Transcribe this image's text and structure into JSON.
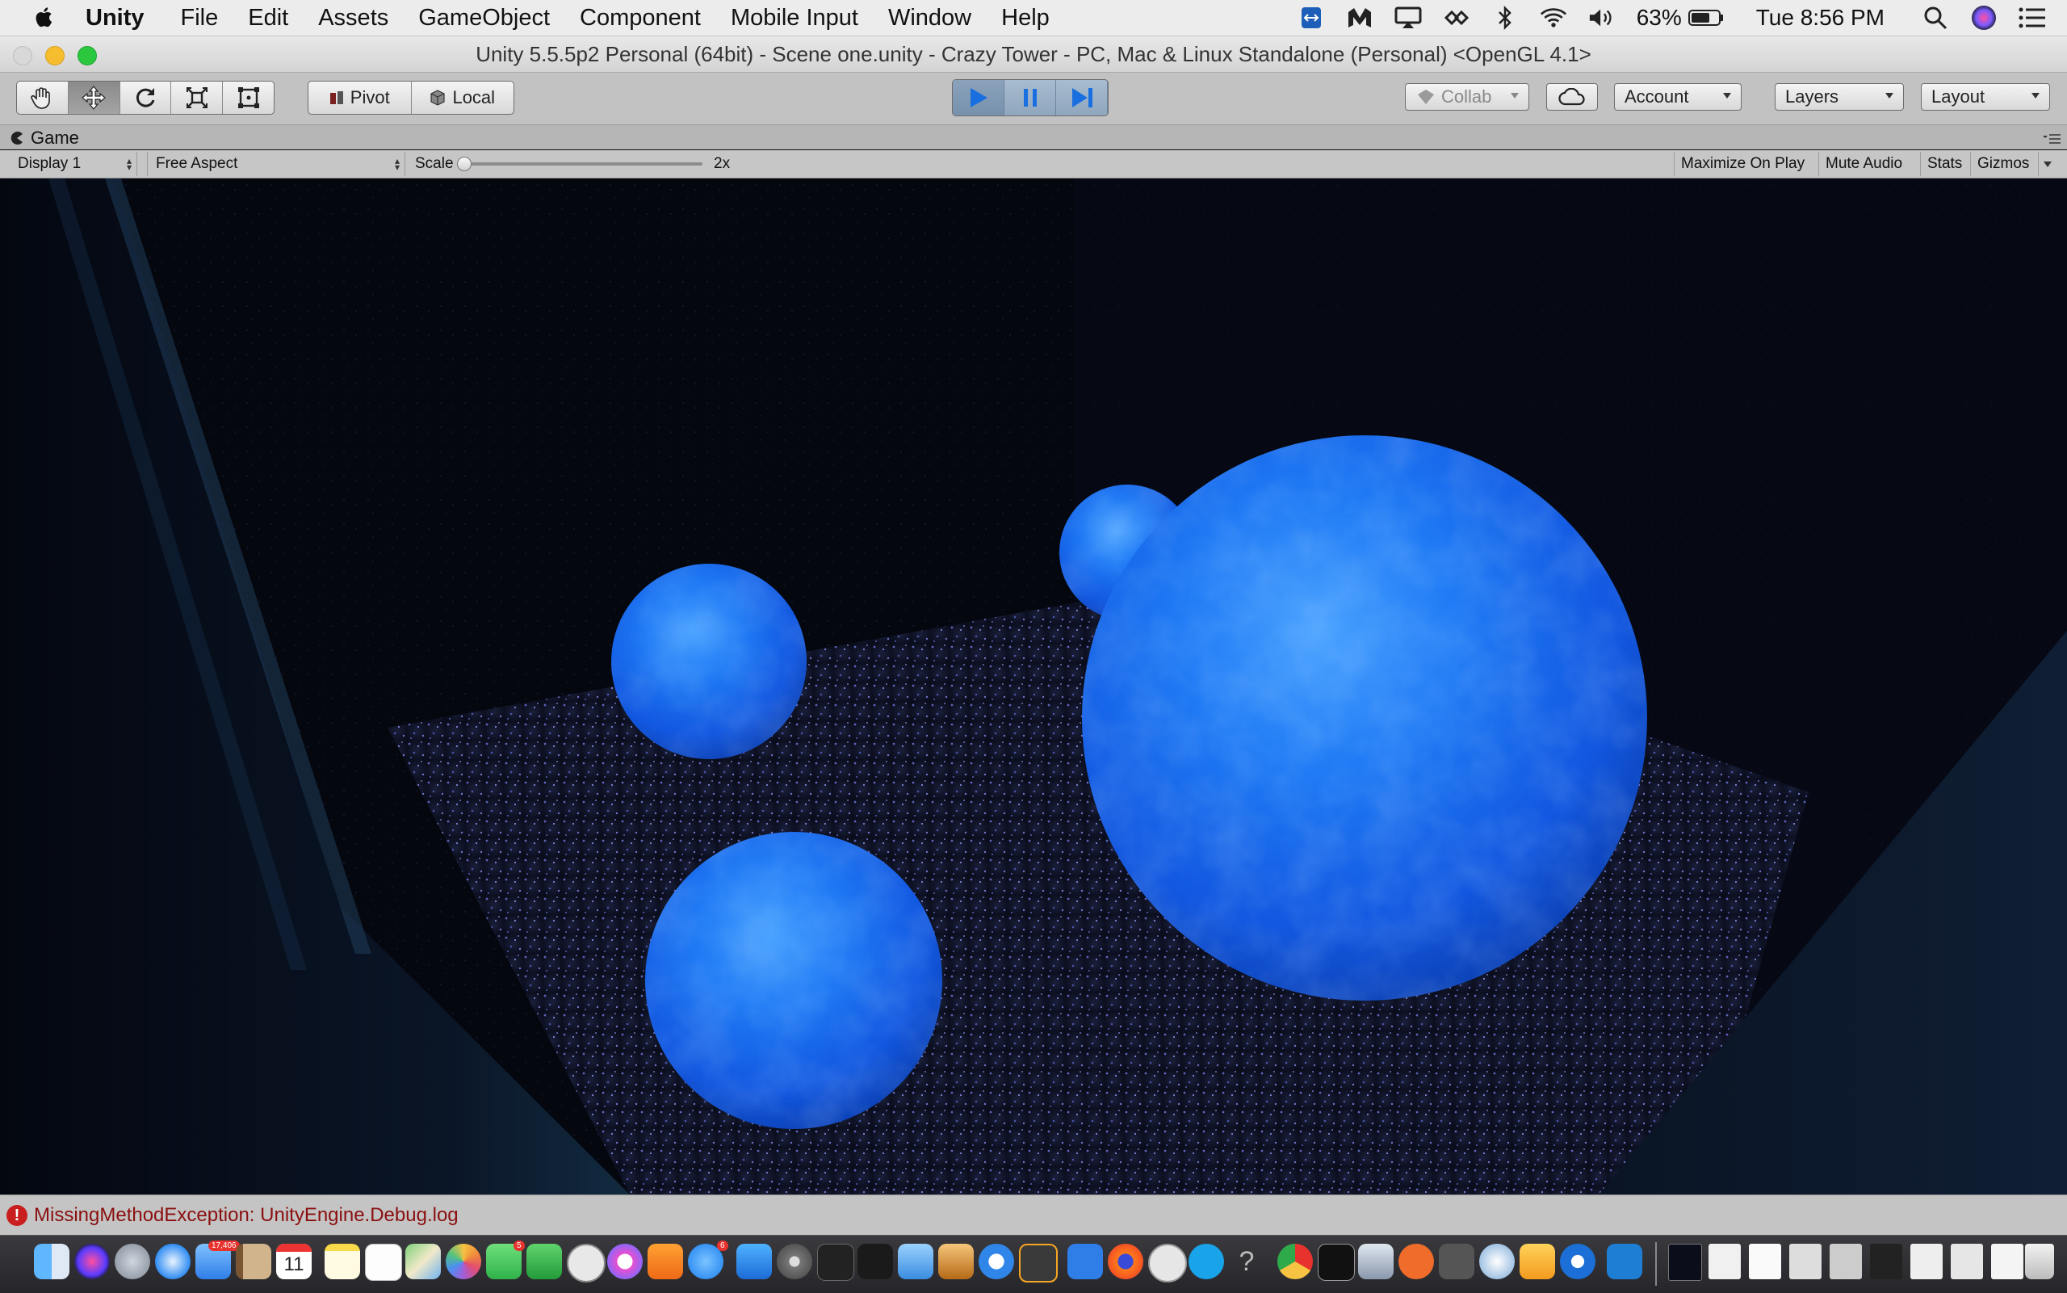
{
  "menubar": {
    "app_name": "Unity",
    "items": [
      "File",
      "Edit",
      "Assets",
      "GameObject",
      "Component",
      "Mobile Input",
      "Window",
      "Help"
    ],
    "battery_percent": "63%",
    "clock": "Tue 8:56 PM",
    "status_icons": [
      "teamviewer-icon",
      "malwarebytes-icon",
      "airplay-icon",
      "link-icon",
      "bluetooth-icon",
      "wifi-icon",
      "volume-icon",
      "battery-icon",
      "spotlight-search-icon",
      "siri-icon",
      "notification-center-icon"
    ]
  },
  "window": {
    "title": "Unity 5.5.5p2 Personal (64bit) - Scene one.unity - Crazy Tower - PC, Mac & Linux Standalone (Personal) <OpenGL 4.1>"
  },
  "toolbar": {
    "transform_tools": [
      "hand-tool",
      "move-tool",
      "rotate-tool",
      "scale-tool",
      "rect-tool"
    ],
    "active_tool": "move-tool",
    "pivot_label": "Pivot",
    "local_label": "Local",
    "play_state": "playing",
    "collab_label": "Collab",
    "account_label": "Account",
    "layers_label": "Layers",
    "layout_label": "Layout"
  },
  "game_panel": {
    "tab_label": "Game",
    "display_label": "Display 1",
    "aspect_label": "Free Aspect",
    "scale_label": "Scale",
    "scale_value": "2x",
    "scale_level": 0.0,
    "maximize_label": "Maximize On Play",
    "mute_label": "Mute Audio",
    "stats_label": "Stats",
    "gizmos_label": "Gizmos"
  },
  "console": {
    "error_message": "MissingMethodException: UnityEngine.Debug.log"
  },
  "colors": {
    "sphere_blue": "#1f6ef0",
    "play_blue": "#1a6fe0",
    "error_red": "#c81e1e",
    "menubar_bg": "#ececec",
    "toolbar_bg": "#c2c2c2"
  },
  "dock": {
    "apps": [
      "finder-icon",
      "siri-icon",
      "launchpad-icon",
      "safari-icon",
      "mail-icon",
      "contacts-icon",
      "calendar-icon",
      "notes-icon",
      "reminders-icon",
      "maps-icon",
      "photos-icon",
      "messages-icon",
      "facetime-icon",
      "numbers-icon",
      "unknown-app-icon",
      "itunes-icon",
      "ibooks-icon",
      "app-store-icon",
      "xcode-icon",
      "system-preferences-icon",
      "unity-icon",
      "vectorize-icon",
      "generic-app-icon",
      "sublime-text-icon",
      "html5-icon",
      "firefox-icon",
      "disabled-app-icon",
      "skype-icon",
      "help-icon",
      "chrome-icon",
      "terminal-icon",
      "scanner-icon",
      "postman-icon",
      "keychain-icon",
      "network-icon",
      "sketch-icon",
      "teamviewer-icon",
      "visual-studio-code-icon",
      "window-thumbnail-icon",
      "downloads-icon",
      "trash-icon"
    ],
    "mail_badge": "17,406",
    "calendar_day": "11",
    "messages_badge": "5",
    "app_store_badge": "6"
  }
}
